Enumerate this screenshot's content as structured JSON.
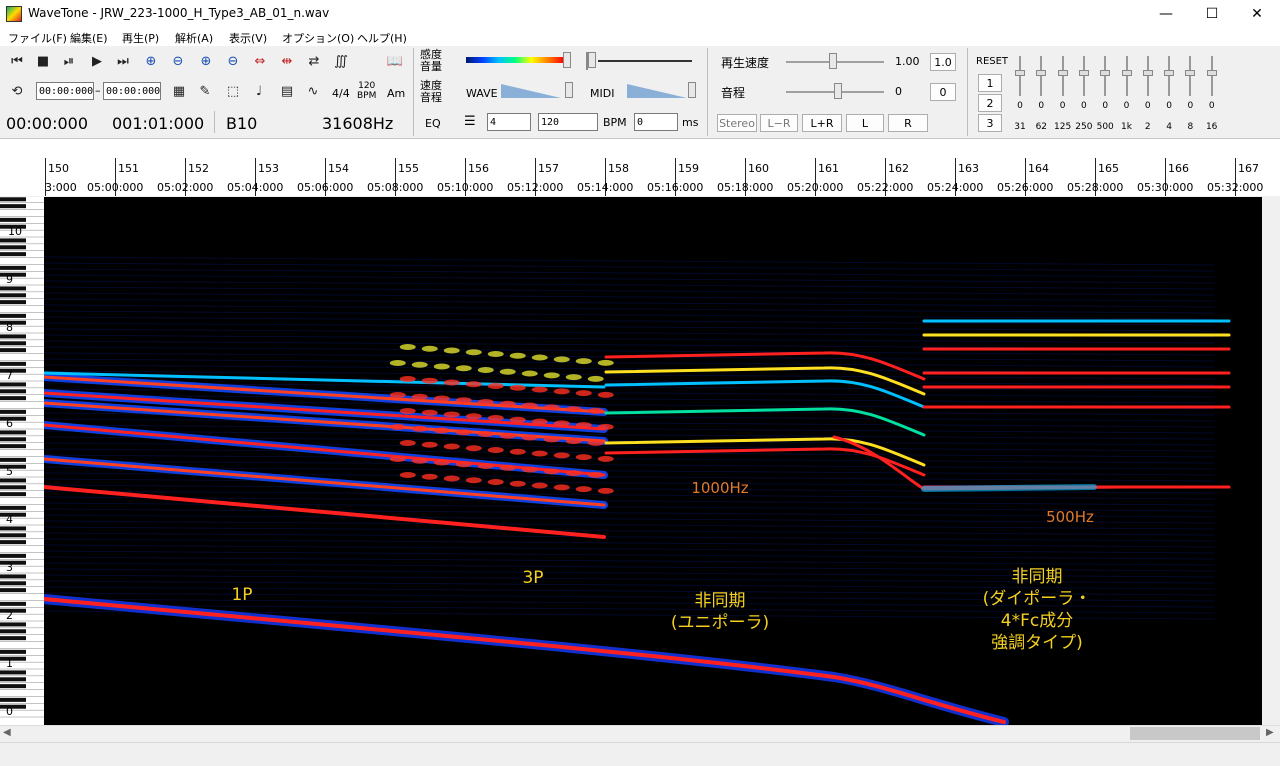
{
  "window": {
    "title": "WaveTone - JRW_223-1000_H_Type3_AB_01_n.wav",
    "controls": {
      "minimize": "—",
      "maximize": "☐",
      "close": "✕"
    }
  },
  "menu": [
    "ファイル(F)",
    "編集(E)",
    "再生(P)",
    "解析(A)",
    "表示(V)",
    "オプション(O)",
    "ヘルプ(H)"
  ],
  "toolbar": {
    "row1_icons": [
      "skip-back-icon",
      "stop-icon",
      "pause-icon",
      "play-icon",
      "skip-forward-icon",
      "zoom-in-time-icon",
      "zoom-out-time-icon",
      "zoom-in-freq-icon",
      "zoom-out-freq-icon",
      "expand-h-icon",
      "shrink-h-icon",
      "arrows-icon",
      "waveform-icon",
      "book-icon"
    ],
    "row2_icons": [
      "loop-icon"
    ],
    "range_start": "00:00:000",
    "range_dash": "–",
    "range_end": "00:00:000",
    "row2_tools": [
      "grid-icon",
      "pencil-icon",
      "select-icon",
      "note-icon",
      "table-icon",
      "curve-icon"
    ],
    "time_signature": "4/4",
    "bpm_label_top": "120",
    "bpm_label_bottom": "BPM",
    "key_label": "Am",
    "status_time": "00:00:000",
    "status_measure": "001:01:000",
    "status_note": "B10",
    "status_freq": "31608Hz",
    "eq_label": "EQ",
    "sensitivity_top": "感度",
    "sensitivity_bottom": "音量",
    "speed_top": "速度",
    "speed_bottom": "音程",
    "wave_label": "WAVE",
    "midi_label": "MIDI",
    "beats_value": "4",
    "tempo_value": "120",
    "bpm_text": "BPM",
    "ms_value": "0",
    "ms_text": "ms",
    "playback_speed_label": "再生速度",
    "playback_speed_value": "1.00",
    "playback_speed_button": "1.0",
    "pitch_label": "音程",
    "pitch_value": "0",
    "pitch_button": "0",
    "stereo_buttons": [
      "Stereo",
      "L−R",
      "L+R",
      "L",
      "R"
    ],
    "reset_label": "RESET",
    "preset_buttons": [
      "1",
      "2",
      "3"
    ],
    "eq_values": [
      "0",
      "0",
      "0",
      "0",
      "0",
      "0",
      "0",
      "0",
      "0",
      "0"
    ],
    "eq_bands": [
      "31",
      "62",
      "125",
      "250",
      "500",
      "1k",
      "2",
      "4",
      "8",
      "16"
    ]
  },
  "ruler": {
    "measures": [
      "150",
      "151",
      "152",
      "153",
      "154",
      "155",
      "156",
      "157",
      "158",
      "159",
      "160",
      "161",
      "162",
      "163",
      "164",
      "165",
      "166",
      "167"
    ],
    "times": [
      "3:000",
      "05:00:000",
      "05:02:000",
      "05:04:000",
      "05:06:000",
      "05:08:000",
      "05:10:000",
      "05:12:000",
      "05:14:000",
      "05:16:000",
      "05:18:000",
      "05:20:000",
      "05:22:000",
      "05:24:000",
      "05:26:000",
      "05:28:000",
      "05:30:000",
      "05:32:000"
    ]
  },
  "piano": {
    "octaves": [
      "10",
      "9",
      "8",
      "7",
      "6",
      "5",
      "4",
      "3",
      "2",
      "1",
      "0"
    ]
  },
  "annotations": {
    "a1": "1P",
    "a2": "3P",
    "a3_line1": "非同期",
    "a3_line2": "(ユニポーラ)",
    "a4_line1": "非同期",
    "a4_line2": "(ダイポーラ・",
    "a4_line3": "4*Fc成分",
    "a4_line4": "強調タイプ)",
    "hz1000": "1000Hz",
    "hz500": "500Hz"
  },
  "colors": {
    "spectrogram_bg": "#000000",
    "trace_red": "#ff2020",
    "trace_blue": "#1040e0",
    "annotation_yellow": "#f4d020",
    "annotation_orange": "#e07a2a"
  }
}
